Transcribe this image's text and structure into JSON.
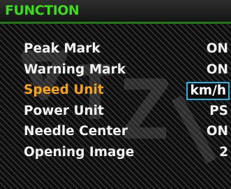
{
  "header": {
    "title": "FUNCTION"
  },
  "menu": {
    "items": [
      {
        "label": "Peak Mark",
        "value": "ON"
      },
      {
        "label": "Warning Mark",
        "value": "ON"
      },
      {
        "label": "Speed Unit",
        "value": "km/h"
      },
      {
        "label": "Power Unit",
        "value": "PS"
      },
      {
        "label": "Needle Center",
        "value": "ON"
      },
      {
        "label": "Opening Image",
        "value": "2"
      }
    ],
    "selected_index": 2
  },
  "colors": {
    "title": "#3bdc1c",
    "selected_label": "#f7a21c",
    "selection_border": "#21b6e8",
    "text": "#f2f2f2"
  }
}
